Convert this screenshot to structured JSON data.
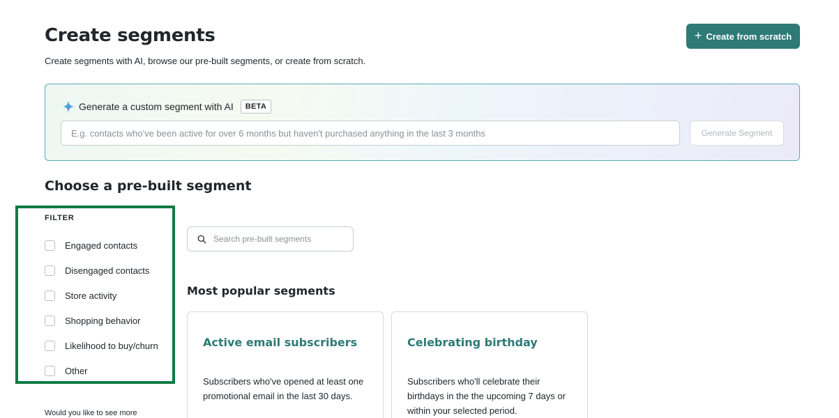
{
  "header": {
    "title": "Create segments",
    "subtitle": "Create segments with AI, browse our pre-built segments, or create from scratch.",
    "create_button_label": "Create from scratch"
  },
  "ai_panel": {
    "heading": "Generate a custom segment with AI",
    "badge": "BETA",
    "input_placeholder": "E.g. contacts who've been active for over 6 months but haven't purchased anything in the last 3 months",
    "input_value": "",
    "generate_button_label": "Generate Segment",
    "icon": "sparkle-icon"
  },
  "prebuilt": {
    "title": "Choose a pre-built segment",
    "filter": {
      "label": "FILTER",
      "items": [
        {
          "label": "Engaged contacts",
          "checked": false
        },
        {
          "label": "Disengaged contacts",
          "checked": false
        },
        {
          "label": "Store activity",
          "checked": false
        },
        {
          "label": "Shopping behavior",
          "checked": false
        },
        {
          "label": "Likelihood to buy/churn",
          "checked": false
        },
        {
          "label": "Other",
          "checked": false
        }
      ],
      "more_text": "Would you like to see more"
    },
    "search": {
      "placeholder": "Search pre-built segments",
      "value": ""
    },
    "popular_title": "Most popular segments",
    "cards": [
      {
        "title": "Active email subscribers",
        "description": "Subscribers who've opened at least one promotional email in the last 30 days."
      },
      {
        "title": "Celebrating birthday",
        "description": "Subscribers who'll celebrate their birthdays in the the upcoming 7 days or within your selected period."
      }
    ]
  },
  "colors": {
    "primary": "#2e7a77",
    "text": "#21262a",
    "filter_highlight": "#117a45",
    "ai_panel_border": "#5aa8b0"
  }
}
